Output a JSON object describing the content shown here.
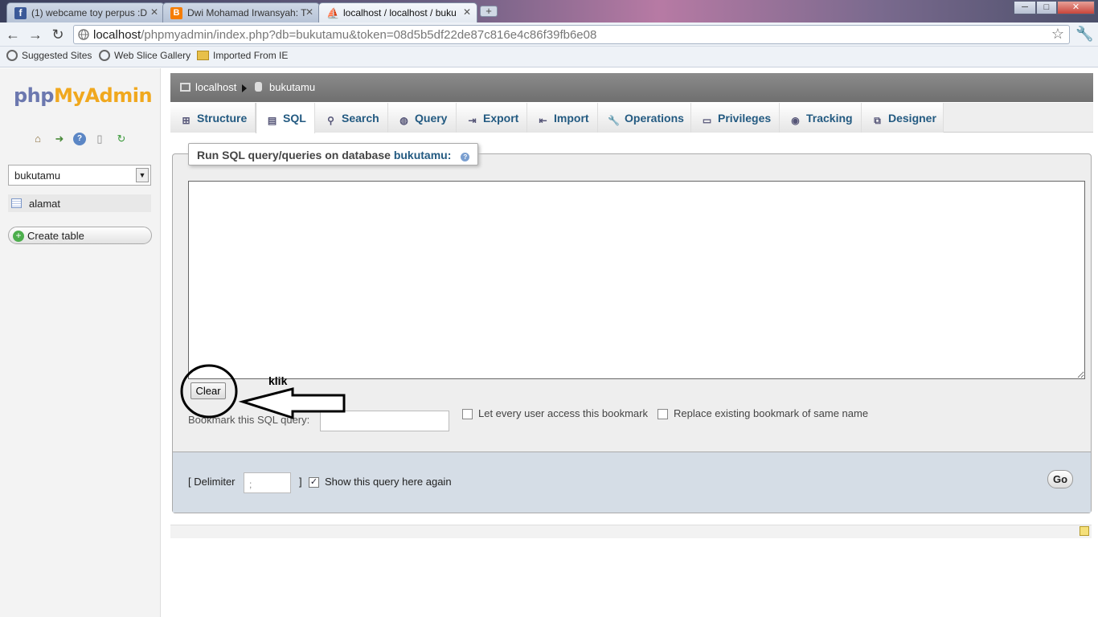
{
  "browser": {
    "tabs": [
      {
        "title": "(1) webcame toy perpus :D",
        "favicon_color": "#3b5998"
      },
      {
        "title": "Dwi Mohamad Irwansyah: T",
        "favicon_color": "#f57d00"
      },
      {
        "title": "localhost / localhost / buku",
        "favicon_color": "#f0a81e"
      }
    ],
    "new_tab": "+",
    "window_buttons": {
      "minimize": "─",
      "maximize": "□",
      "close": "✕"
    },
    "url_host": "localhost",
    "url_path": "/phpmyadmin/index.php?db=bukutamu&token=08d5b5df22de87c816e4c86f39fb6e08",
    "bookmarks": [
      {
        "label": "Suggested Sites",
        "icon": "globe-icon"
      },
      {
        "label": "Web Slice Gallery",
        "icon": "globe-icon"
      },
      {
        "label": "Imported From IE",
        "icon": "folder-icon"
      }
    ]
  },
  "pma": {
    "logo_php": "php",
    "logo_myadmin": "MyAdmin",
    "database_select": "bukutamu",
    "tables": [
      "alamat"
    ],
    "create_table": "Create table",
    "breadcrumb": {
      "server": "localhost",
      "database": "bukutamu"
    },
    "tabs": [
      "Structure",
      "SQL",
      "Search",
      "Query",
      "Export",
      "Import",
      "Operations",
      "Privileges",
      "Tracking",
      "Designer"
    ],
    "active_tab": "SQL",
    "legend_prefix": "Run SQL query/queries on database",
    "legend_db": "bukutamu:",
    "sql_text": "",
    "clear_label": "Clear",
    "bookmark_label": "Bookmark this SQL query:",
    "bookmark_value": "",
    "let_every_user": "Let every user access this bookmark",
    "replace_existing": "Replace existing bookmark of same name",
    "delimiter_open": "[ Delimiter",
    "delimiter_value": ";",
    "delimiter_close": "]",
    "show_query_again": "Show this query here again",
    "show_query_checked": true,
    "go_label": "Go"
  },
  "annotation": {
    "text": "klik"
  }
}
